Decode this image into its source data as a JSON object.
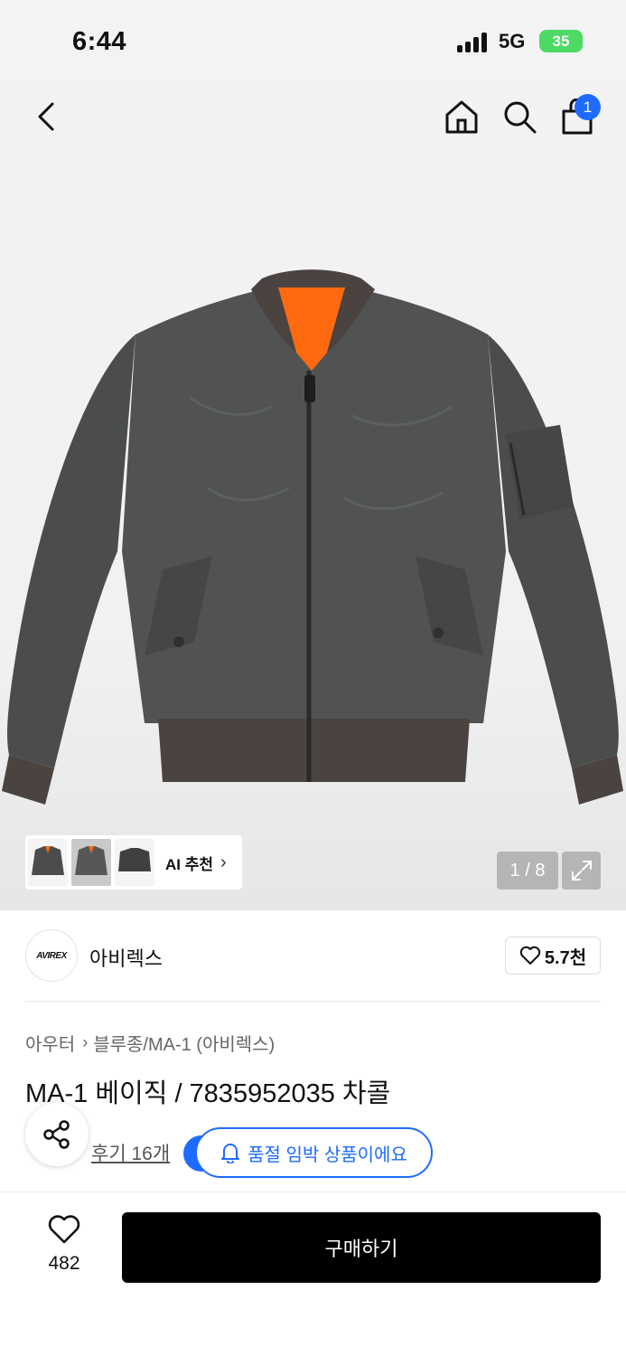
{
  "status_bar": {
    "time": "6:44",
    "network": "5G",
    "battery": "35"
  },
  "nav": {
    "cart_count": "1"
  },
  "gallery": {
    "counter": "1 / 8",
    "ai_label": "AI 추천"
  },
  "brand": {
    "logo_text": "AVIREX",
    "name": "아비렉스",
    "likes": "5.7천"
  },
  "breadcrumb": {
    "category": "아우터",
    "subcategory": "블루종/MA-1 (아비렉스)"
  },
  "product": {
    "title": "MA-1 베이직 / 7835952035 차콜",
    "reviews": "후기 16개",
    "soldout_notice": "품절 임박 상품이에요"
  },
  "bottom_bar": {
    "wish_count": "482",
    "buy_label": "구매하기"
  },
  "colors": {
    "accent": "#1f6bff",
    "jacket": "#4a4d4c",
    "lining": "#ff6a10",
    "rib": "#4a4340"
  }
}
